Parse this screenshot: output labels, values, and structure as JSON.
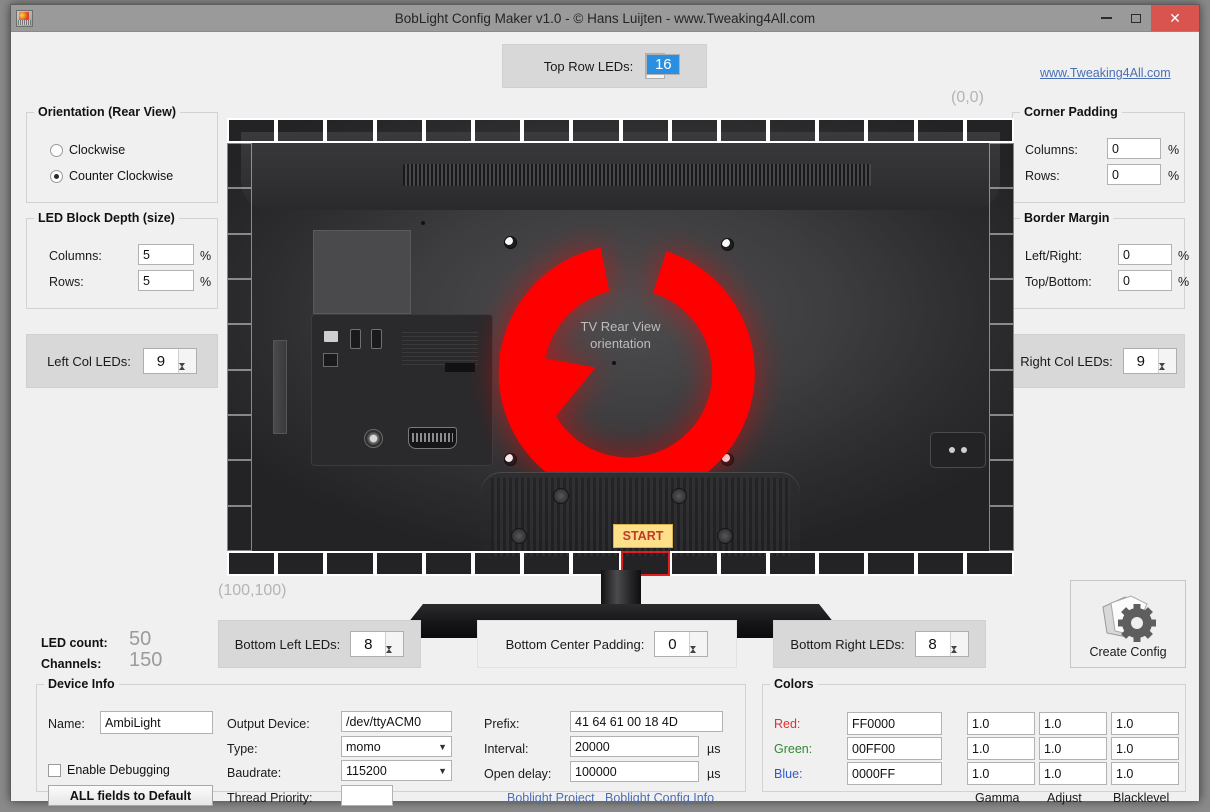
{
  "window": {
    "title": "BobLight Config Maker v1.0 - © Hans Luijten - www.Tweaking4All.com",
    "minimize": "–",
    "maximize": "□",
    "close": "✕"
  },
  "header": {
    "site_link": "www.Tweaking4All.com",
    "top_row": {
      "label": "Top Row LEDs:",
      "value": "16"
    },
    "coord_top_left": "(0,0)",
    "coord_bottom_left": "(100,100)"
  },
  "orientation": {
    "legend": "Orientation (Rear View)",
    "options": [
      {
        "label": "Clockwise",
        "selected": false
      },
      {
        "label": "Counter Clockwise",
        "selected": true
      }
    ]
  },
  "led_block_depth": {
    "legend": "LED Block Depth (size)",
    "rows": [
      {
        "label": "Columns:",
        "value": "5",
        "unit": "%"
      },
      {
        "label": "Rows:",
        "value": "5",
        "unit": "%"
      }
    ]
  },
  "corner_padding": {
    "legend": "Corner Padding",
    "rows": [
      {
        "label": "Columns:",
        "value": "0",
        "unit": "%"
      },
      {
        "label": "Rows:",
        "value": "0",
        "unit": "%"
      }
    ]
  },
  "border_margin": {
    "legend": "Border Margin",
    "rows": [
      {
        "label": "Left/Right:",
        "value": "0",
        "unit": "%"
      },
      {
        "label": "Top/Bottom:",
        "value": "0",
        "unit": "%"
      }
    ]
  },
  "side_spinners": {
    "left_col": {
      "label": "Left Col LEDs:",
      "value": "9"
    },
    "right_col": {
      "label": "Right Col LEDs:",
      "value": "9"
    }
  },
  "bottom_spinners": {
    "bottom_left": {
      "label": "Bottom Left LEDs:",
      "value": "8"
    },
    "bottom_center": {
      "label": "Bottom Center Padding:",
      "value": "0"
    },
    "bottom_right": {
      "label": "Bottom Right LEDs:",
      "value": "8"
    }
  },
  "counters": {
    "led_count_label": "LED count:",
    "led_count_value": "50",
    "channels_label": "Channels:",
    "channels_value": "150"
  },
  "create_config": {
    "label": "Create Config",
    "icon": "gear-document-icon"
  },
  "tv_preview": {
    "caption_line1": "TV Rear View",
    "caption_line2": "orientation",
    "start_button": "START",
    "arrow_color": "#FF0000",
    "top_blocks": 16,
    "bottom_blocks": 16,
    "left_blocks": 9,
    "right_blocks": 9,
    "active_bottom_index": 9
  },
  "device_info": {
    "legend": "Device Info",
    "name_label": "Name:",
    "name_value": "AmbiLight",
    "enable_debugging_label": "Enable Debugging",
    "enable_debugging_checked": false,
    "default_button": "ALL fields to Default",
    "output_device_label": "Output Device:",
    "output_device_value": "/dev/ttyACM0",
    "type_label": "Type:",
    "type_value": "momo",
    "baudrate_label": "Baudrate:",
    "baudrate_value": "115200",
    "thread_priority_label": "Thread Priority:",
    "thread_priority_value": "",
    "prefix_label": "Prefix:",
    "prefix_value": "41 64 61 00 18 4D",
    "interval_label": "Interval:",
    "interval_value": "20000",
    "interval_unit": "µs",
    "open_delay_label": "Open delay:",
    "open_delay_value": "100000",
    "open_delay_unit": "µs",
    "link_project": "Boblight Project",
    "link_config_info": "Boblight Config Info"
  },
  "colors": {
    "legend": "Colors",
    "rows": [
      {
        "label": "Red:",
        "hex": "FF0000",
        "gamma": "1.0",
        "adjust": "1.0",
        "blacklevel": "1.0",
        "color": "#E03030"
      },
      {
        "label": "Green:",
        "hex": "00FF00",
        "gamma": "1.0",
        "adjust": "1.0",
        "blacklevel": "1.0",
        "color": "#2E8B2E"
      },
      {
        "label": "Blue:",
        "hex": "0000FF",
        "gamma": "1.0",
        "adjust": "1.0",
        "blacklevel": "1.0",
        "color": "#3058D0"
      }
    ],
    "col_gamma": "Gamma",
    "col_adjust": "Adjust",
    "col_blacklevel": "Blacklevel"
  }
}
